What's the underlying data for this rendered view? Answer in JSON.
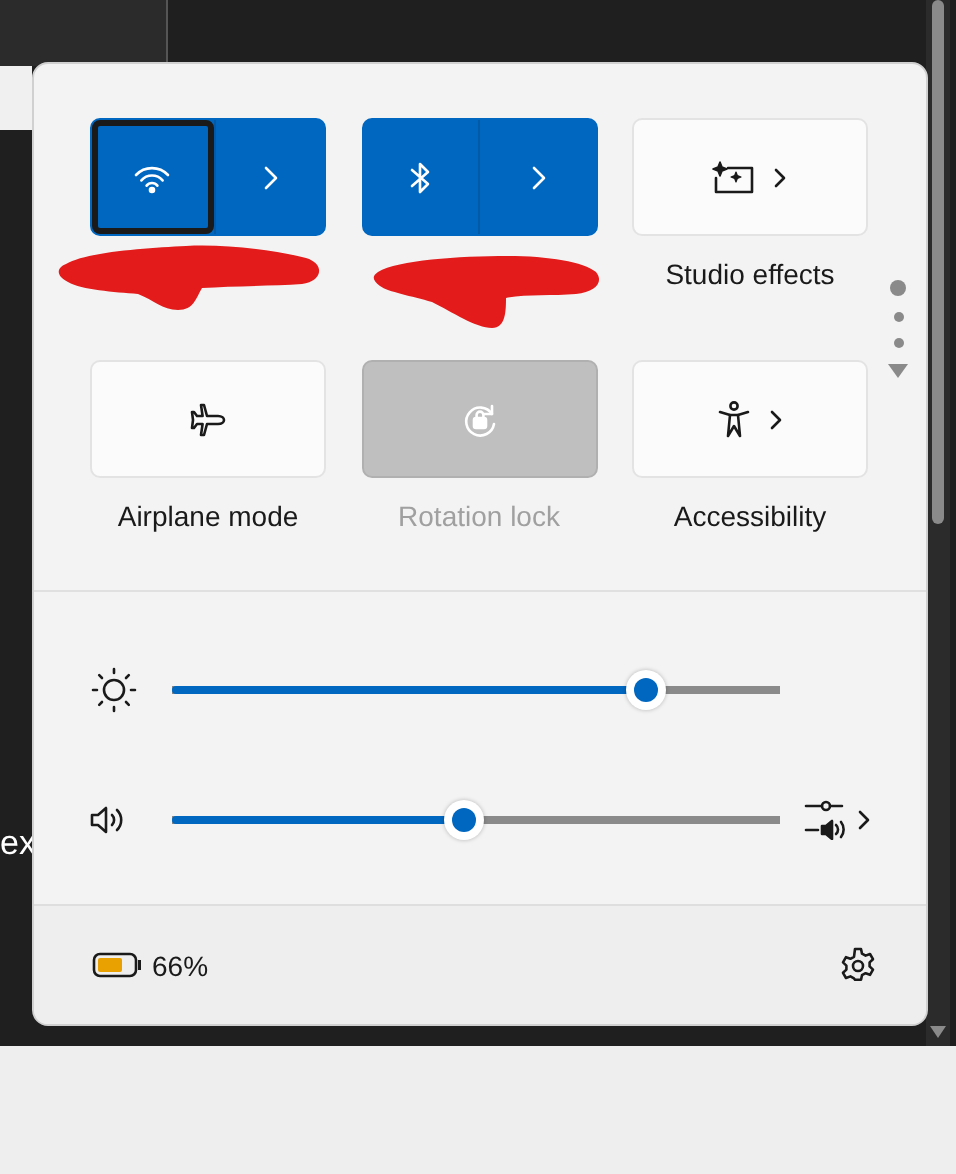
{
  "background": {
    "text": "ex"
  },
  "quick_settings": {
    "tiles": [
      {
        "kind": "wifi",
        "on": true,
        "focused": true,
        "disabled": false
      },
      {
        "kind": "bluetooth",
        "on": true,
        "focused": false,
        "disabled": false
      },
      {
        "kind": "studio_effects",
        "label": "Studio effects",
        "on": false,
        "focused": false,
        "disabled": false
      },
      {
        "kind": "airplane_mode",
        "label": "Airplane mode",
        "on": false,
        "focused": false,
        "disabled": false
      },
      {
        "kind": "rotation_lock",
        "label": "Rotation lock",
        "on": false,
        "focused": false,
        "disabled": true
      },
      {
        "kind": "accessibility",
        "label": "Accessibility",
        "on": false,
        "focused": false,
        "disabled": false
      }
    ],
    "pages": [
      {
        "selected": true
      },
      {
        "selected": false
      },
      {
        "selected": false
      }
    ],
    "sliders": [
      {
        "kind": "brightness",
        "level": 0.78
      },
      {
        "kind": "volume",
        "level": 0.48
      }
    ],
    "battery": {
      "reading": "66%"
    }
  }
}
